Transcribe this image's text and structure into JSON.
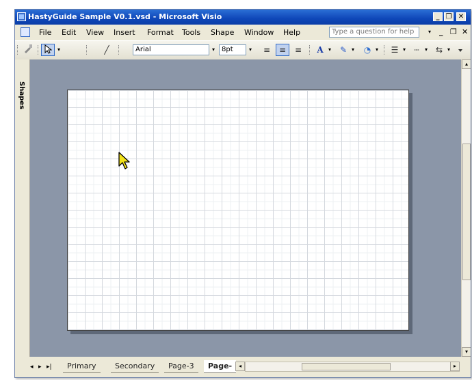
{
  "window": {
    "title": "HastyGuide Sample V0.1.vsd - Microsoft Visio",
    "controls": {
      "minimize": "_",
      "restore": "❐",
      "close": "✕"
    }
  },
  "menu": {
    "items": [
      "File",
      "Edit",
      "View",
      "Insert",
      "Format",
      "Tools",
      "Shape",
      "Window",
      "Help"
    ],
    "ask_placeholder": "Type a question for help",
    "mdi_controls": [
      "▾",
      "_",
      "❐",
      "✕"
    ]
  },
  "toolbar": {
    "pointer_arrow": "▾",
    "line_tool": "╱",
    "font_name": "Arial",
    "font_size": "8pt",
    "dropdown_arrow": "▾",
    "align_left": "≡",
    "align_center": "≡",
    "align_right": "≡",
    "font_color_label": "A",
    "line_color_label": "✎",
    "fill_color_label": "◔",
    "line_weight_label": "☰",
    "line_pattern_label": "┄",
    "line_ends_label": "⇆"
  },
  "shapes_panel": {
    "label": "Shapes"
  },
  "page_tabs": {
    "nav": [
      "◂",
      "▸",
      "▸|"
    ],
    "tabs": [
      "Primary",
      "Secondary",
      "Page-3",
      "Page-"
    ],
    "current": "Page-"
  },
  "scroll": {
    "up": "▴",
    "down": "▾",
    "left": "◂",
    "right": "▸"
  },
  "colors": {
    "title_bar": "#0f47b8",
    "canvas_bg": "#8b96a8",
    "cursor": "#f2e21b"
  }
}
